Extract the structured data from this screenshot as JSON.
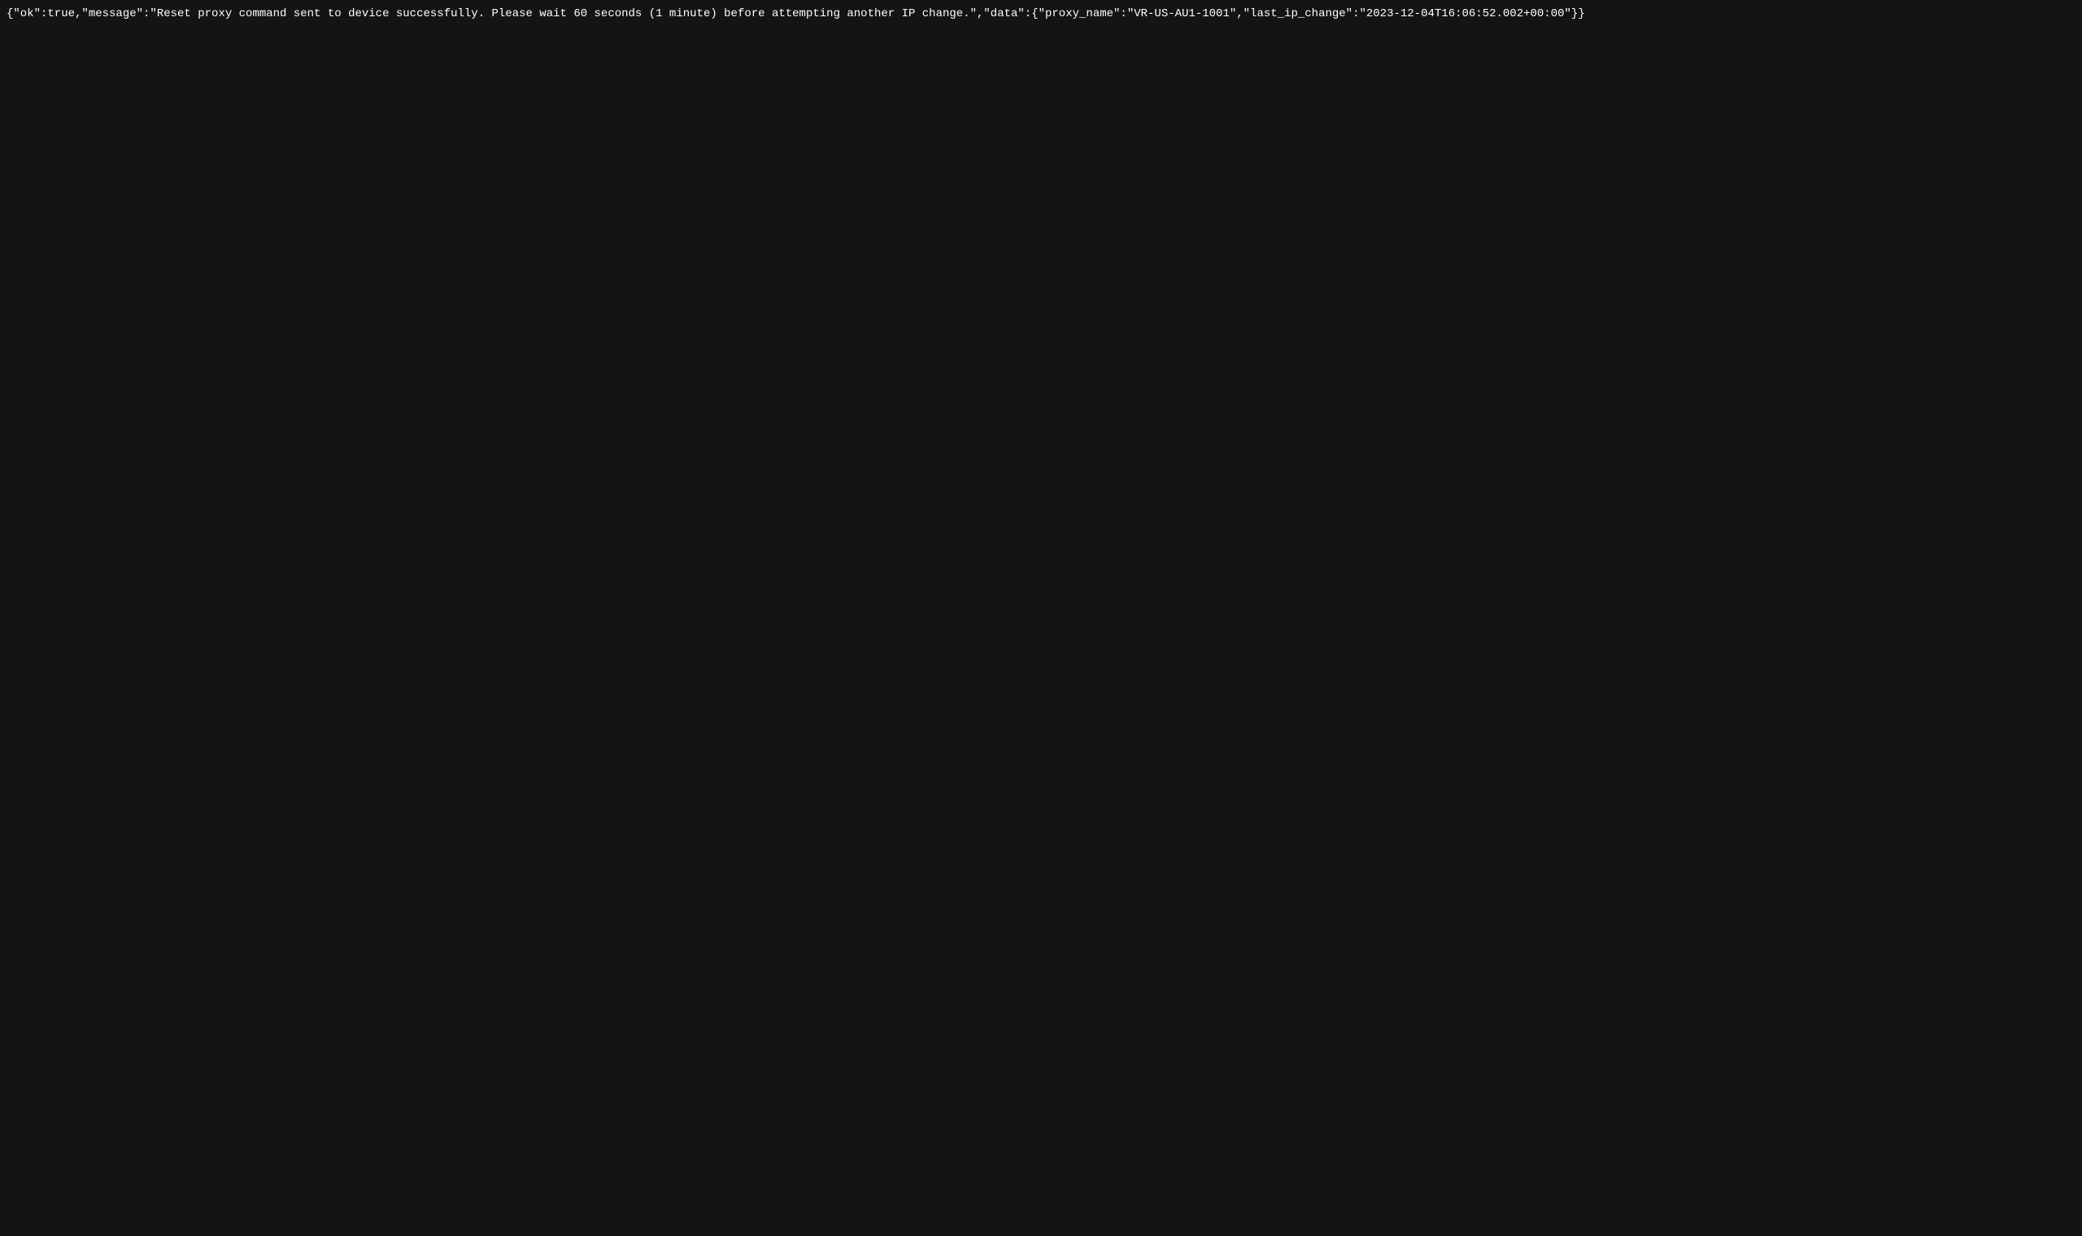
{
  "response": {
    "raw_text": "{\"ok\":true,\"message\":\"Reset proxy command sent to device successfully. Please wait 60 seconds (1 minute) before attempting another IP change.\",\"data\":{\"proxy_name\":\"VR-US-AU1-1001\",\"last_ip_change\":\"2023-12-04T16:06:52.002+00:00\"}}"
  }
}
